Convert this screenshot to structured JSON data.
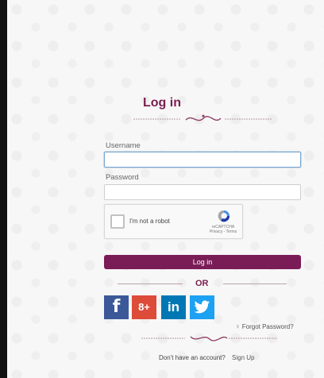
{
  "form": {
    "title": "Log in",
    "username_label": "Username",
    "username_value": "",
    "password_label": "Password",
    "password_value": "",
    "captcha": {
      "label": "I'm not a robot",
      "brand": "reCAPTCHA",
      "links": "Privacy - Terms"
    },
    "login_button": "Log in",
    "or_text": "OR",
    "social": {
      "facebook": "f",
      "google_plus": "8+",
      "linkedin": "in",
      "twitter_icon": "twitter-bird-icon"
    },
    "forgot_password": "Forgot Password?",
    "no_account": "Don't have an account?",
    "sign_up": "Sign Up"
  },
  "colors": {
    "accent": "#7a1d57",
    "facebook": "#3b5998",
    "google_plus": "#dd4b39",
    "linkedin": "#0077b5",
    "twitter": "#1da1f2"
  }
}
